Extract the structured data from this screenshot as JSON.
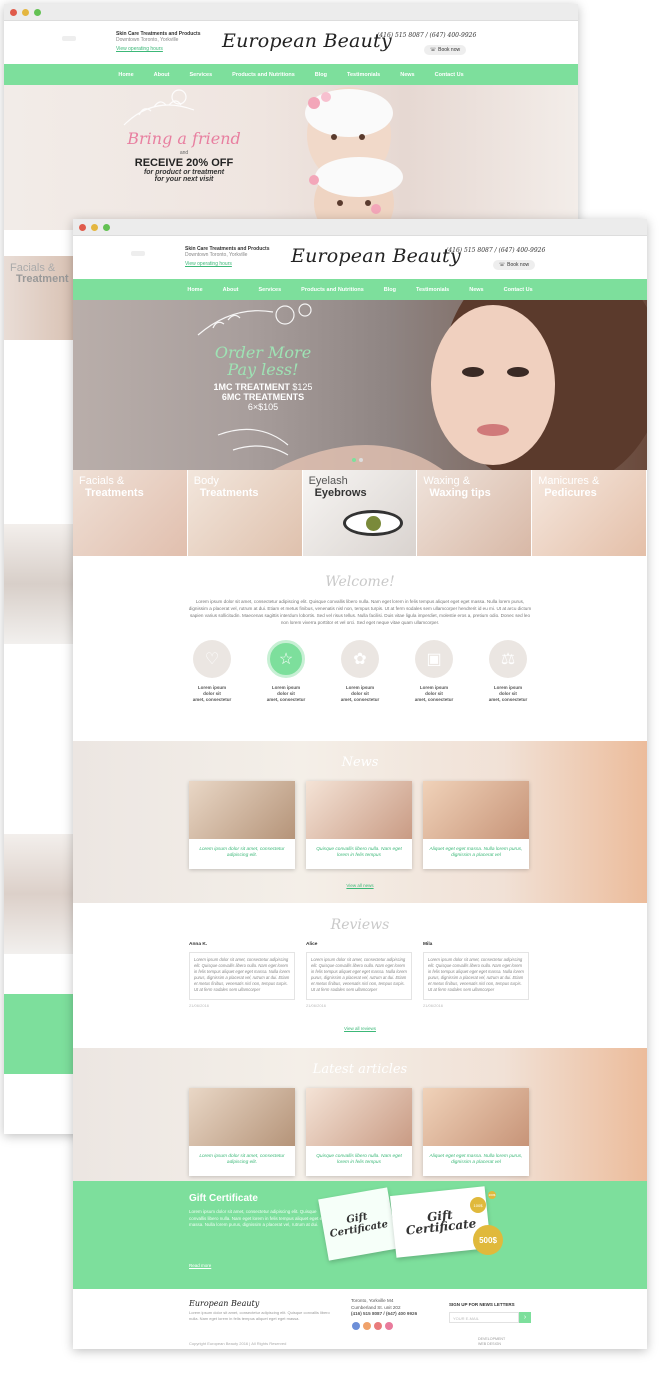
{
  "site": {
    "logo": "European Beauty",
    "tagline": "Skin Care Treatments and Products",
    "location": "Downtown Toronto, Yorkville",
    "hours_link": "View operating hours",
    "phones": "(416) 515 8087 / (647) 400-9926",
    "book_label": "Book now"
  },
  "nav": [
    "Home",
    "About",
    "Services",
    "Products and Nutritions",
    "Blog",
    "Testimonials",
    "News",
    "Contact Us"
  ],
  "back_hero": {
    "script": "Bring a friend",
    "and": "and",
    "offer": "RECEIVE 20% OFF",
    "sub1": "for product or treatment",
    "sub2": "for your next visit"
  },
  "back_side": {
    "cat1": "Facials &",
    "cat2": "Treatment"
  },
  "front_hero": {
    "script1": "Order More",
    "script2": "Pay less!",
    "line1_bold": "1MC TREATMENT",
    "line1_price": "$125",
    "line2_bold": "6MC TREATMENTS",
    "line2_price": "6×$105"
  },
  "categories": [
    {
      "light": "Facials &",
      "bold": "Treatments"
    },
    {
      "light": "Body",
      "bold": "Treatments"
    },
    {
      "light": "Eyelash",
      "bold": "Eyebrows"
    },
    {
      "light": "Waxing &",
      "bold": "Waxing tips"
    },
    {
      "light": "Manicures &",
      "bold": "Pedicures"
    }
  ],
  "welcome": {
    "title": "Welcome!",
    "text": "Lorem ipsum dolor sit amet, consectetur adipiscing elit. Quisque convallis libero nulla. Nam eget lorem in felis tempus aliquet eget eget massa. Nulla lorem purus, dignissim a placerat vel, rutrum at dui. Etiam et metus finibus, venenatis nisl non, tempus turpis. Ut at ferm sodales sem ullamcorper hendrerit id eu mi. Ut at arcu dictum sapien varius sollicitudin. Maecenas sagittis interdum lobortis. Sed vel risus tellus. Nulla facilisi. Duis vitae ligula imperdiet, molestie eros a, pretium odio. Donec sed leo non lorem viverra porttitor et vel orci. Sed eget neque vitae quam ullamcorper."
  },
  "features": [
    {
      "icon": "heart-icon",
      "line1": "Lorem ipsum dolor sit",
      "line2": "amet, consectetur"
    },
    {
      "icon": "star-icon",
      "line1": "Lorem ipsum dolor sit",
      "line2": "amet, consectetur"
    },
    {
      "icon": "butterfly-icon",
      "line1": "Lorem ipsum dolor sit",
      "line2": "amet, consectetur"
    },
    {
      "icon": "gift-icon",
      "line1": "Lorem ipsum dolor sit",
      "line2": "amet, consectetur"
    },
    {
      "icon": "scales-icon",
      "line1": "Lorem ipsum dolor sit",
      "line2": "amet, consectetur"
    }
  ],
  "news": {
    "title": "News",
    "items": [
      "Lorem ipsum dolor sit amet, consectetur adipiscing elit.",
      "Quisque convallis libero nulla. Nam eget lorem in felis tempus",
      "Aliquet eget eget massa. Nulla lorem purus, dignissim a placerat vel"
    ],
    "view_all": "View all news"
  },
  "reviews": {
    "title": "Reviews",
    "items": [
      {
        "name": "Anna K.",
        "text": "Lorem ipsum dolor sit amet, consectetur adipiscing elit. Quisque convallis libero nulla. Nam eget lorem in felis tempus aliquet eget eget massa. Nulla lorem purus, dignissim a placerat vel, rutrum at dui. Etiam et metus finibus, venenatis nisl non, tempus turpis. Ut at ferm sodales sem ullamcorper",
        "date": "21/06/2016"
      },
      {
        "name": "Alice",
        "text": "Lorem ipsum dolor sit amet, consectetur adipiscing elit. Quisque convallis libero nulla. Nam eget lorem in felis tempus aliquet eget eget massa. Nulla lorem purus, dignissim a placerat vel, rutrum at dui. Etiam et metus finibus, venenatis nisl non, tempus turpis. Ut at ferm sodales sem ullamcorper",
        "date": "21/06/2016"
      },
      {
        "name": "Mila",
        "text": "Lorem ipsum dolor sit amet, consectetur adipiscing elit. Quisque convallis libero nulla. Nam eget lorem in felis tempus aliquet eget eget massa. Nulla lorem purus, dignissim a placerat vel, rutrum at dui. Etiam et metus finibus, venenatis nisl non, tempus turpis. Ut at ferm sodales sem ullamcorper",
        "date": "21/06/2016"
      }
    ],
    "view_all": "View all reviews"
  },
  "articles": {
    "title": "Latest articles",
    "items": [
      "Lorem ipsum dolor sit amet, consectetur adipiscing elit.",
      "Quisque convallis libero nulla. Nam eget lorem in felis tempus",
      "Aliquet eget eget massa. Nulla lorem purus, dignissim a placerat vel"
    ],
    "view_all": "View all articles"
  },
  "gift": {
    "title": "Gift Certificate",
    "text": "Lorem ipsum dolor sit amet, consectetur adipiscing elit. Quisque convallis libero nulla. Nam eget lorem in felis tempus aliquet eget eget massa. Nulla lorem purus, dignissim a placerat vel, rutrum at dui.",
    "read_more": "Read more",
    "cert1": "Gift Certificate",
    "cert2": "Gift Certificate",
    "amount1": "200$",
    "amount2": "500$",
    "badge": "100$"
  },
  "footer": {
    "logo": "European Beauty",
    "text": "Lorem ipsum dolor sit amet, consectetur adipiscing elit. Quisque convallis libero nulla. Nam eget lorem in felis tempus aliquet eget eget massa.",
    "addr1": "Toronto, Yorkville M4",
    "addr2": "Cumberland St. unit 202",
    "phones": "(416) 515 8087 / (647) 400 9926",
    "newsletter": "SIGN UP FOR NEWS LETTERS",
    "email_placeholder": "YOUR E-MAIL",
    "copyright": "Copyright European Beauty 2016 | All Rights Reserved",
    "dev1": "DEVELOPMENT",
    "dev2": "WEB DESIGN"
  },
  "colors": {
    "accent": "#7ddf9c",
    "accent_dark": "#3cb878"
  }
}
